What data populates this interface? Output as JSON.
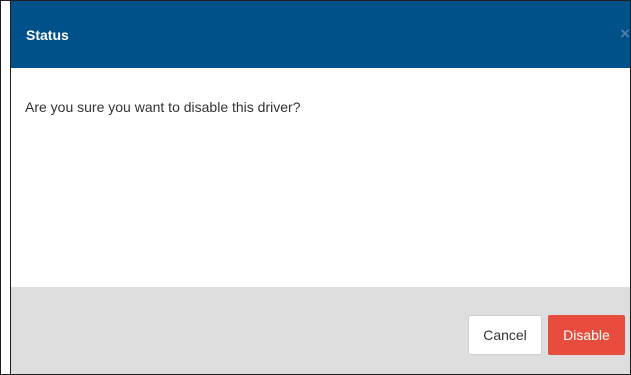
{
  "dialog": {
    "title": "Status",
    "close_icon": "close-icon",
    "message": "Are you sure you want to disable this driver?",
    "buttons": {
      "cancel_label": "Cancel",
      "disable_label": "Disable"
    }
  },
  "colors": {
    "header_bg": "#00508a",
    "footer_bg": "#dedede",
    "danger": "#e84c3d"
  }
}
